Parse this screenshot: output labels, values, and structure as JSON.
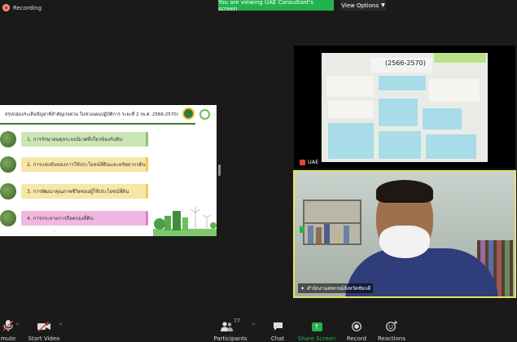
{
  "topbar": {
    "recording_label": "Recording",
    "viewing_banner": "You are viewing UAE Consultant's screen",
    "view_options_label": "View Options"
  },
  "slide": {
    "title": "สรุปกลุ่มประเด็นปัญหาที่สำคัญเร่งด่วน ในช่วงแผนปฏิบัติการ ระยะที่ 2 (พ.ศ. 2566-2570)",
    "items": [
      {
        "label": "1. การรักษาสมดุลระบบนิเวศที่เกี่ยวข้องกับดิน",
        "style": "green"
      },
      {
        "label": "2. การแข่งขันของการใช้ประโยชน์ที่ดินและทรัพยากรดิน",
        "style": "yellow"
      },
      {
        "label": "3. การพัฒนาคุณภาพชีวิตของผู้ใช้ประโยชน์ที่ดิน",
        "style": "yellow"
      },
      {
        "label": "4. การกระจายการถือครองที่ดิน",
        "style": "pink"
      }
    ]
  },
  "uae_tile": {
    "name": "UAE",
    "board_heading": "(2566-2570)"
  },
  "local_tile": {
    "name": "สำนักงานสหกรณ์จังหวัดชัยบดี"
  },
  "toolbar": {
    "mute_label": "mute",
    "start_video_label": "Start Video",
    "participants_label": "Participants",
    "participants_count": "77",
    "chat_label": "Chat",
    "share_screen_label": "Share Screen",
    "record_label": "Record",
    "reactions_label": "Reactions"
  },
  "colors": {
    "accent_green": "#22b24c",
    "recording_red": "#e8412e",
    "active_speaker_border": "#e4e36a",
    "background": "#1a1a1a"
  }
}
